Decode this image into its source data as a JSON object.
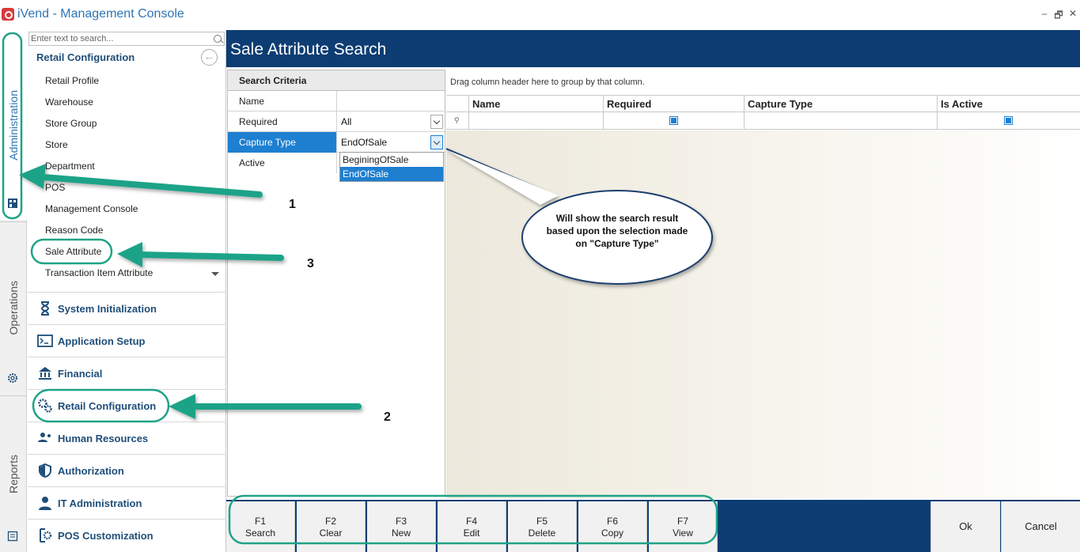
{
  "window": {
    "title": "iVend - Management Console",
    "controls": [
      "–",
      "🗗",
      "✕"
    ]
  },
  "vertical_tabs": [
    {
      "label": "Administration",
      "icon": "admin-icon",
      "active": true
    },
    {
      "label": "Operations",
      "icon": "gear-icon"
    },
    {
      "label": "Reports",
      "icon": "report-icon"
    }
  ],
  "nav": {
    "search_placeholder": "Enter text to search...",
    "group_title": "Retail Configuration",
    "items": [
      "Retail Profile",
      "Warehouse",
      "Store Group",
      "Store",
      "Department",
      "POS",
      "Management Console",
      "Reason Code",
      "Sale Attribute",
      "Transaction Item Attribute"
    ],
    "sections": [
      {
        "label": "System Initialization",
        "icon": "hourglass-icon"
      },
      {
        "label": "Application Setup",
        "icon": "terminal-icon"
      },
      {
        "label": "Financial",
        "icon": "bank-icon"
      },
      {
        "label": "Retail Configuration",
        "icon": "gears-icon"
      },
      {
        "label": "Human Resources",
        "icon": "people-icon"
      },
      {
        "label": "Authorization",
        "icon": "shield-icon"
      },
      {
        "label": "IT Administration",
        "icon": "admin-user-icon"
      },
      {
        "label": "POS Customization",
        "icon": "pos-gear-icon"
      }
    ]
  },
  "header": {
    "title": "Sale Attribute Search"
  },
  "criteria": {
    "title": "Search Criteria",
    "rows": [
      {
        "label": "Name",
        "value": ""
      },
      {
        "label": "Required",
        "value": "All"
      },
      {
        "label": "Capture Type",
        "value": "EndOfSale"
      },
      {
        "label": "Active",
        "value": ""
      }
    ],
    "dropdown_options": [
      "BeginingOfSale",
      "EndOfSale"
    ],
    "dropdown_selected": "EndOfSale"
  },
  "grid": {
    "group_hint": "Drag column header here to group by that column.",
    "columns": [
      "Name",
      "Required",
      "Capture Type",
      "Is Active"
    ],
    "rows": []
  },
  "toolbar": {
    "function_keys": [
      {
        "key": "F1",
        "label": "Search"
      },
      {
        "key": "F2",
        "label": "Clear"
      },
      {
        "key": "F3",
        "label": "New"
      },
      {
        "key": "F4",
        "label": "Edit"
      },
      {
        "key": "F5",
        "label": "Delete"
      },
      {
        "key": "F6",
        "label": "Copy"
      },
      {
        "key": "F7",
        "label": "View"
      }
    ],
    "ok_label": "Ok",
    "cancel_label": "Cancel"
  },
  "annotations": {
    "step_1": "1",
    "step_2": "2",
    "step_3": "3",
    "callout": "Will show the search result based upon the selection made on \"Capture Type\""
  },
  "colors": {
    "header_bg": "#0d3d73",
    "accent_blue": "#1e7fd0",
    "nav_title": "#1f4e79",
    "annotation_green": "#1fa387"
  }
}
